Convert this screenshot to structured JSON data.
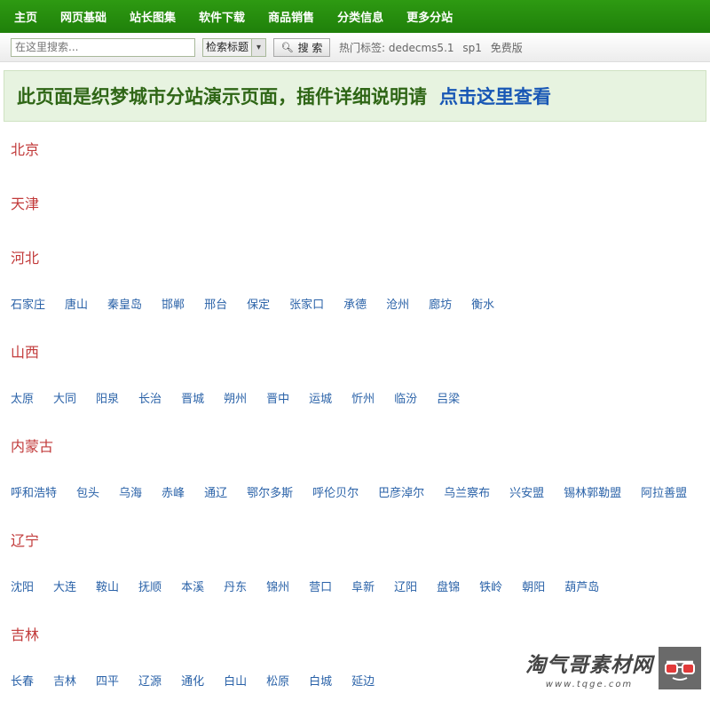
{
  "nav": [
    "主页",
    "网页基础",
    "站长图集",
    "软件下载",
    "商品销售",
    "分类信息",
    "更多分站"
  ],
  "search": {
    "placeholder": "在这里搜索...",
    "select_value": "检索标题",
    "button_label": "搜 索",
    "hot_label": "热门标签:",
    "hot_tags": [
      "dedecms5.1",
      "sp1",
      "免费版"
    ]
  },
  "banner": {
    "text": "此页面是织梦城市分站演示页面，插件详细说明请",
    "link": "点击这里查看"
  },
  "provinces": [
    {
      "name": "北京",
      "cities": []
    },
    {
      "name": "天津",
      "cities": []
    },
    {
      "name": "河北",
      "cities": [
        "石家庄",
        "唐山",
        "秦皇岛",
        "邯郸",
        "邢台",
        "保定",
        "张家口",
        "承德",
        "沧州",
        "廊坊",
        "衡水"
      ]
    },
    {
      "name": "山西",
      "cities": [
        "太原",
        "大同",
        "阳泉",
        "长治",
        "晋城",
        "朔州",
        "晋中",
        "运城",
        "忻州",
        "临汾",
        "吕梁"
      ]
    },
    {
      "name": "内蒙古",
      "cities": [
        "呼和浩特",
        "包头",
        "乌海",
        "赤峰",
        "通辽",
        "鄂尔多斯",
        "呼伦贝尔",
        "巴彦淖尔",
        "乌兰察布",
        "兴安盟",
        "锡林郭勒盟",
        "阿拉善盟"
      ]
    },
    {
      "name": "辽宁",
      "cities": [
        "沈阳",
        "大连",
        "鞍山",
        "抚顺",
        "本溪",
        "丹东",
        "锦州",
        "营口",
        "阜新",
        "辽阳",
        "盘锦",
        "铁岭",
        "朝阳",
        "葫芦岛"
      ]
    },
    {
      "name": "吉林",
      "cities": [
        "长春",
        "吉林",
        "四平",
        "辽源",
        "通化",
        "白山",
        "松原",
        "白城",
        "延边"
      ]
    }
  ],
  "watermark": {
    "title": "淘气哥素材网",
    "url": "www.tqge.com"
  },
  "colors": {
    "nav_green": "#1f800a",
    "province_red": "#c23b3b",
    "city_blue": "#2a62a8",
    "banner_text": "#2f6616",
    "banner_link": "#1857b5"
  }
}
